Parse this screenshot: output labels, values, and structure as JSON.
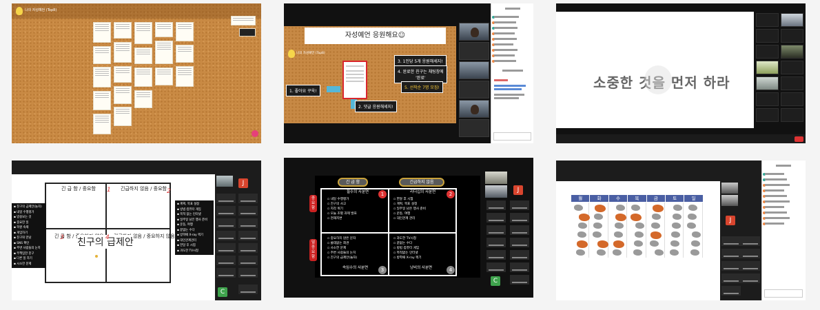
{
  "gallery": {
    "shot1": {
      "board_title": "나의 자성예언 (Top8)",
      "colors": {
        "cork": "#c98a44",
        "note": "#fffdf5",
        "fab": "#e6407a"
      },
      "icons": [
        "lightbulb-icon",
        "add-post-icon"
      ]
    },
    "shot2": {
      "banner": "자성예언 응원해요☺",
      "board_title": "나의 자성예언 (Top8)",
      "step1": "1. 좋아요 꾸욱!",
      "step2": "2. 댓글 응원해세지!",
      "step3": "3. 1인당 5개 응원해세지!",
      "step4a": "4. 완료한 친구는 채팅창에",
      "step4b": "'완료'",
      "step5": "5. 선착순 7명 모집!",
      "colors": {
        "board": "#c78945",
        "highlight": "#d9262c",
        "arrow": "#55b7d8",
        "gold": "#ffcf3a"
      }
    },
    "shot3": {
      "slide_text": "소중한 것을 먼저 하라",
      "colors": {
        "end": "#dd3333"
      }
    },
    "shot4": {
      "quadrants": {
        "tl": "긴 급 함 / 중요함",
        "tr": "긴급하지 않음 / 중요함",
        "bl": "긴 급 함 / 중요하지 않음",
        "br": "긴급하지 않음 / 중요하지 않음"
      },
      "center": "친구의 급제안",
      "left_list": [
        "친구의 급제안(놀자)",
        "내일 수행평가",
        "방송보는 것",
        "중요한 일",
        "학원 숙제",
        "게임하기",
        "친구와 만남",
        "SNS 확인",
        "주변 사람들의 눈치",
        "무책임한 친구",
        "다른 일 하기",
        "시소한 문제"
      ],
      "right_list": [
        "계획, 목표 설정",
        "방법 컴퓨터 게임",
        "목적 없는 인터넷",
        "일주일 남은 행사 준비",
        "운동, 여행",
        "끝없는 수다",
        "방학때 X-ray 찍기",
        "대인관계관리",
        "한달 후 시험",
        "과도한 TV시청"
      ],
      "avatar_j": "J",
      "avatar_c": "C",
      "colors": {
        "mark": "#dd3333",
        "avatar_j": "#d9452e",
        "avatar_c": "#3fa34d"
      }
    },
    "shot5": {
      "header_left": "긴 급 함",
      "header_right": "긴급하지 않음",
      "side_top": "중요함",
      "side_bottom": "덜 중요함",
      "q1_title": "필수의 사분면",
      "q1_items": [
        "내일 수행평가",
        "친구의 사고",
        "지각 위기",
        "오늘 조별 과제 발표",
        "천재지변"
      ],
      "q2_title": "리더십의 사분면",
      "q2_items": [
        "한달 후 시험",
        "계획, 목표 설정",
        "일주일 남은 행사 준비",
        "운동, 여행",
        "대인관계 관리"
      ],
      "q3_items": [
        "중요하지 않은 문자",
        "쓸데없는 회견",
        "사소한 문제",
        "주변 사람들의 눈치",
        "친구의 급제안(놀자)"
      ],
      "q3_title": "속임수의 사분면",
      "q4_items": [
        "과도한 TV시청",
        "끝없는 수다",
        "방법 컴퓨터 게임",
        "목적없는 인터넷",
        "방학때 X-ray 찍기"
      ],
      "q4_title": "낭비의 사분면",
      "nums": [
        "1",
        "2",
        "3",
        "4"
      ],
      "avatar_j": "J",
      "avatar_c": "C",
      "colors": {
        "pill_border": "#c9a23a",
        "label": "#cc2222",
        "q1": "#d33",
        "q2": "#d33"
      }
    },
    "shot6": {
      "days": [
        "월",
        "화",
        "수",
        "목",
        "금",
        "토",
        "일"
      ],
      "avatar_j": "J",
      "colors": {
        "header": "#4a5fa3",
        "blob_gray": "#9a9a9a",
        "blob_orange": "#d4692a"
      }
    }
  }
}
